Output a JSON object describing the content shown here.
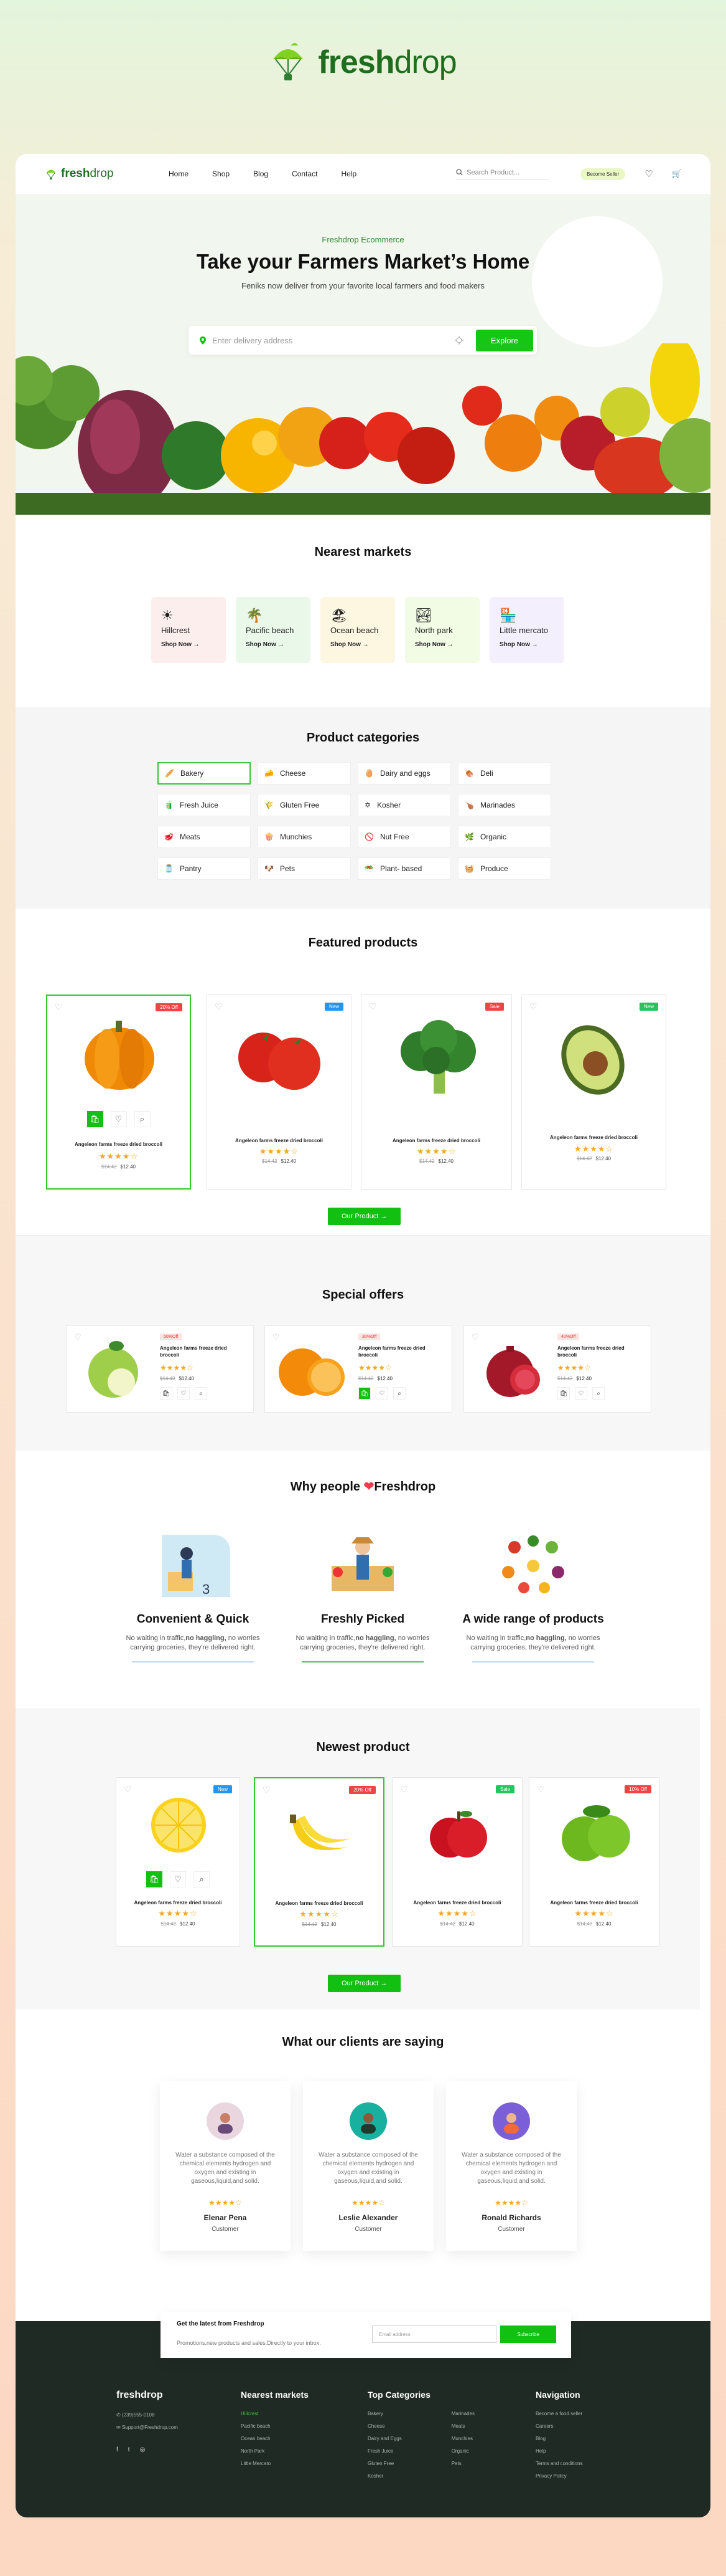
{
  "brand": {
    "logo_name": "freshdrop",
    "logo_part1": "fresh",
    "logo_part2": "drop"
  },
  "nav": {
    "logo_part1": "fresh",
    "logo_part2": "drop",
    "links": [
      "Home",
      "Shop",
      "Blog",
      "Contact",
      "Help"
    ],
    "search_placeholder": "Search Product...",
    "newsletter_label": "Become Seller"
  },
  "hero": {
    "eyebrow": "Freshdrop Ecommerce",
    "title": "Take your Farmers Market’s Home",
    "subtitle": "Feniks now deliver from your favorite local farmers and food makers",
    "address_placeholder": "Enter delivery address",
    "explore_label": "Explore"
  },
  "markets": {
    "title": "Nearest markets",
    "items": [
      {
        "name": "Hillcrest",
        "link": "Shop Now",
        "color": "#fdeeee"
      },
      {
        "name": "Pacific beach",
        "link": "Shop Now",
        "color": "#eaf8ea"
      },
      {
        "name": "Ocean beach",
        "link": "Shop Now",
        "color": "#fdf7e2"
      },
      {
        "name": "North park",
        "link": "Shop Now",
        "color": "#f2fbe4"
      },
      {
        "name": "Little  mercato",
        "link": "Shop Now",
        "color": "#f3effc"
      }
    ]
  },
  "categories": {
    "title": "Product categories",
    "items": [
      "Bakery",
      "Cheese",
      "Dairy and eggs",
      "Deli",
      "Fresh Juice",
      "Gluten Free",
      "Kosher",
      "Marinades",
      "Meats",
      "Munchies",
      "Nut Free",
      "Organic",
      "Pantry",
      "Pets",
      "Plant- based",
      "Produce"
    ]
  },
  "featured": {
    "title": "Featured products",
    "button": "Our Product  →",
    "products": [
      {
        "name": "Angeleon farms freeze dried broccoli",
        "badge": "20% Off",
        "badge_color": "#ef4444",
        "old": "$14.42",
        "price": "$12.40",
        "rating": 4
      },
      {
        "name": "Angeleon farms freeze dried broccoli",
        "badge": "New",
        "badge_color": "#2196f3",
        "old": "$14.42",
        "price": "$12.40",
        "rating": 4
      },
      {
        "name": "Angeleon farms freeze dried broccoli",
        "badge": "Sale",
        "badge_color": "#ef4444",
        "old": "$14.42",
        "price": "$12.40",
        "rating": 4
      },
      {
        "name": "Angeleon farms freeze dried broccoli",
        "badge": "New",
        "badge_color": "#22c55e",
        "old": "$14.42",
        "price": "$12.40",
        "rating": 4
      }
    ]
  },
  "offers": {
    "title": "Special offers",
    "items": [
      {
        "badge": "50%Off",
        "name": "Angeleon farms freeze dried broccoli",
        "old": "$14.42",
        "price": "$12.40",
        "rating": 4
      },
      {
        "badge": "30%Off",
        "name": "Angeleon farms freeze dried broccoli",
        "old": "$14.42",
        "price": "$12.40",
        "rating": 4
      },
      {
        "badge": "40%Off",
        "name": "Angeleon farms freeze dried broccoli",
        "old": "$14.42",
        "price": "$12.40",
        "rating": 4
      }
    ]
  },
  "why": {
    "title_before": "Why people",
    "title_after": "Freshdrop",
    "items": [
      {
        "title": "Convenient & Quick",
        "desc_before": "No waiting in traffic,",
        "desc_bold": "no haggling,",
        "desc_after": " no worries carrying groceries, they're delivered right."
      },
      {
        "title": "Freshly Picked",
        "desc_before": "No waiting in traffic,",
        "desc_bold": "no haggling,",
        "desc_after": " no worries carrying groceries, they're delivered right."
      },
      {
        "title": "A wide range of products",
        "desc_before": "No waiting in traffic,",
        "desc_bold": "no haggling,",
        "desc_after": " no worries carrying groceries, they're delivered right."
      }
    ]
  },
  "newest": {
    "title": "Newest product",
    "button": "Our Product  →",
    "products": [
      {
        "name": "Angeleon farms freeze dried broccoli",
        "badge": "New",
        "badge_color": "#2196f3",
        "old": "$14.42",
        "price": "$12.40",
        "rating": 4
      },
      {
        "name": "Angeleon farms freeze dried broccoli",
        "badge": "20% Off",
        "badge_color": "#ef4444",
        "old": "$14.42",
        "price": "$12.40",
        "rating": 4
      },
      {
        "name": "Angeleon farms freeze dried broccoli",
        "badge": "Sale",
        "badge_color": "#22c55e",
        "old": "$14.42",
        "price": "$12.40",
        "rating": 4
      },
      {
        "name": "Angeleon farms freeze dried broccoli",
        "badge": "10% Off",
        "badge_color": "#ef4444",
        "old": "$14.42",
        "price": "$12.40",
        "rating": 4
      }
    ]
  },
  "testimonials": {
    "title": "What our clients are saying",
    "items": [
      {
        "quote": "Water a substance composed of the chemical elements hydrogen and oxygen and existing in gaseous,liquid,and solid.",
        "name": "Elenar Pena",
        "role": "Customer"
      },
      {
        "quote": "Water a substance composed of the chemical elements hydrogen and oxygen and existing in gaseous,liquid,and solid.",
        "name": "Leslie Alexander",
        "role": "Customer"
      },
      {
        "quote": "Water a substance composed of the chemical elements hydrogen and oxygen and existing in gaseous,liquid,and solid.",
        "name": "Ronald Richards",
        "role": "Customer"
      }
    ]
  },
  "newsletter": {
    "title": "Get the latest from Freshdrop",
    "desc": "Promotions,new products and sales.Directly to your inbox.",
    "placeholder": "Email address",
    "button": "Subscribe"
  },
  "footer": {
    "logo": "freshdrop",
    "phone": "(239)555-0108",
    "email": "Support@Freshdrop.com",
    "nearest_title": "Nearest markets",
    "nearest": [
      "Hillcrest",
      "Pacific beach",
      "Ocean beach",
      "North Park",
      "Little Mercato"
    ],
    "categories_title": "Top Categories",
    "categories_a": [
      "Bakery",
      "Cheese",
      "Dairy and Eggs",
      "Fresh Juice",
      "Gluten Free",
      "Kosher"
    ],
    "categories_b": [
      "Marinades",
      "Meats",
      "Munchies",
      "Organic",
      "Pets"
    ],
    "navigation_title": "Navigation",
    "navigation": [
      "Become a food seller",
      "Careers",
      "Blog",
      "Help",
      "Terms and conditions",
      "Privacy Policy"
    ]
  }
}
